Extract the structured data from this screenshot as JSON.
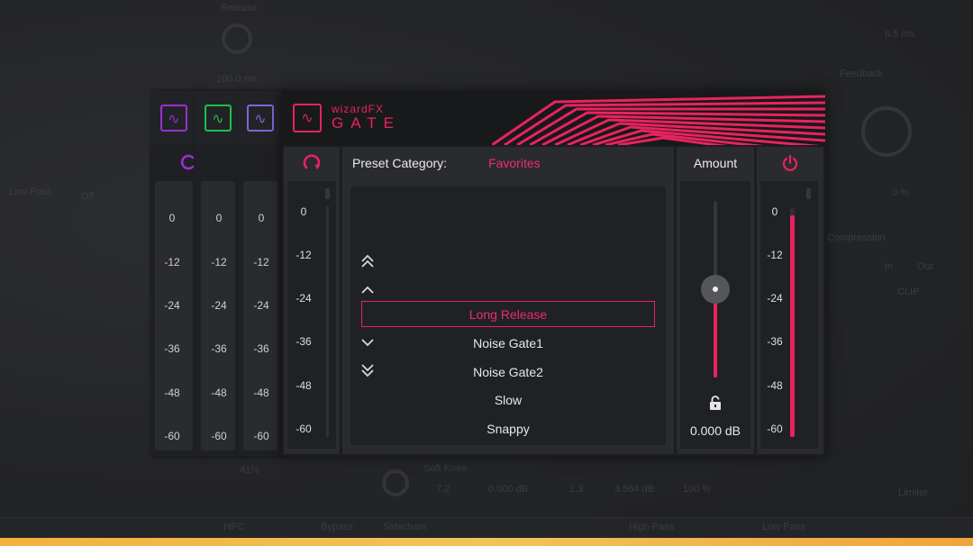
{
  "background": {
    "labels": [
      "Release",
      "100.0 ms",
      "Feedback",
      "6.5 ms",
      "0 %",
      "Low Pass",
      "Off",
      "Compression",
      "In",
      "Out",
      "CLIP",
      "Limiter",
      "41%",
      "Soft Knee",
      "7.2",
      "0.000 dB",
      "1.3",
      "3.564 dB",
      "100 %",
      "Bypass",
      "HPC",
      "High Pass",
      "Low Pass",
      "Sidechain"
    ]
  },
  "ghost_channels": [
    {
      "color": "#9b2fd0"
    },
    {
      "color": "#1fbf4a"
    },
    {
      "color": "#7b67d9"
    }
  ],
  "meter_scale": [
    "0",
    "-12",
    "-24",
    "-36",
    "-48",
    "-60"
  ],
  "plugin": {
    "brand": "wizardFX",
    "product": "GATE",
    "accent": "#e8235f",
    "logo_icon": "sine-wave-icon"
  },
  "preset": {
    "category_label": "Preset Category:",
    "category_value": "Favorites",
    "selected": "Long Release",
    "items_after": [
      "Noise Gate1",
      "Noise Gate2",
      "Slow",
      "Snappy"
    ]
  },
  "amount": {
    "label": "Amount",
    "value": "0.000 dB",
    "slider_level": 0.5
  },
  "output_meter_level": 0.97
}
